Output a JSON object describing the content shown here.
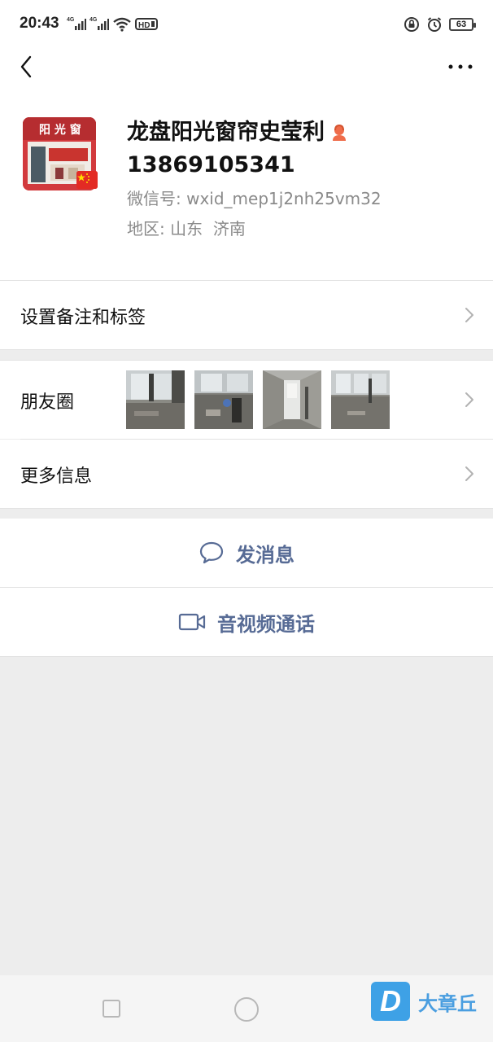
{
  "status_bar": {
    "time": "20:43",
    "network_left": "4G",
    "network_right": "4G",
    "hd_label": "HD",
    "battery": "63"
  },
  "profile": {
    "name": "龙盘阳光窗帘史莹利",
    "phone": "13869105341",
    "wxid_label": "微信号",
    "wxid": "wxid_mep1j2nh25vm32",
    "region_label": "地区",
    "region": "山东  济南",
    "avatar_sign_text": "阳光窗",
    "accent_color": "#ef6c4a"
  },
  "settings": {
    "remark_label": "设置备注和标签"
  },
  "moments": {
    "label": "朋友圈",
    "thumbnails": [
      "room-photo-1",
      "room-photo-2",
      "room-photo-3",
      "room-photo-4"
    ]
  },
  "more_info": {
    "label": "更多信息"
  },
  "actions": {
    "message_label": "发消息",
    "call_label": "音视频通话",
    "action_color": "#576b95"
  },
  "watermark": {
    "logo_letter": "D",
    "text": "大章丘"
  }
}
